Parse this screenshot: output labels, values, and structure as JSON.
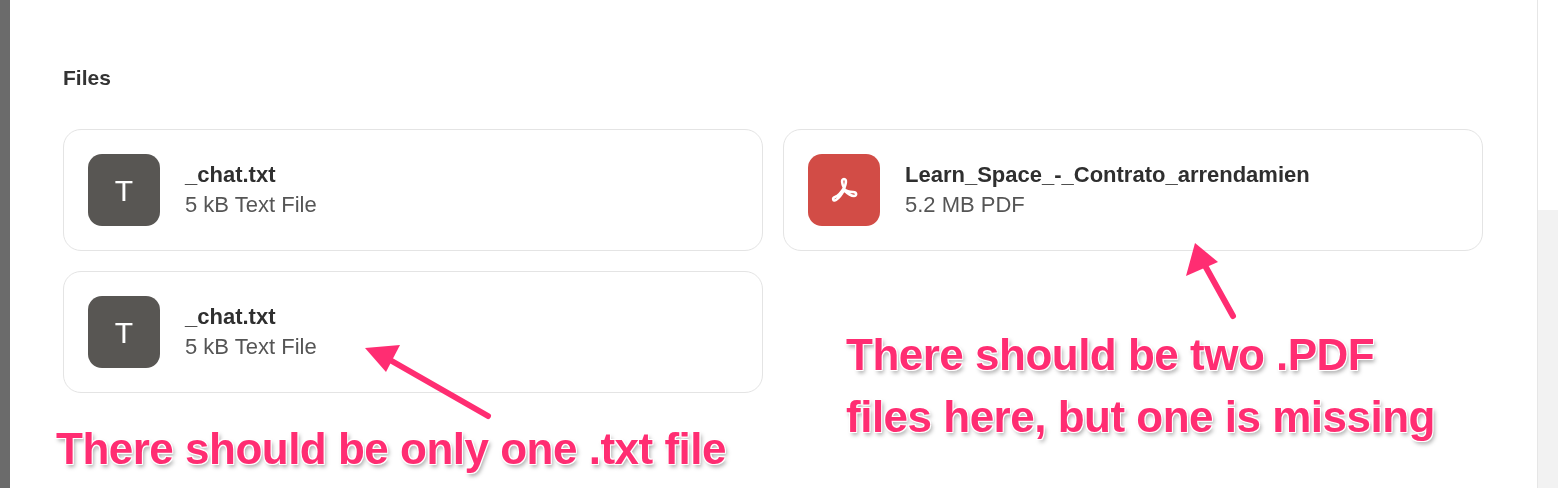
{
  "section_title": "Files",
  "files": [
    {
      "kind": "text",
      "icon_letter": "T",
      "name": "_chat.txt",
      "meta": "5 kB Text File"
    },
    {
      "kind": "pdf",
      "name": "Learn_Space_-_Contrato_arrendamien",
      "meta": "5.2 MB PDF"
    },
    {
      "kind": "text",
      "icon_letter": "T",
      "name": "_chat.txt",
      "meta": "5 kB Text File"
    }
  ],
  "annotations": [
    {
      "lines": [
        "There should be two .PDF",
        "files here, but one is missing"
      ]
    },
    {
      "lines": [
        "There should be only one .txt file"
      ]
    }
  ]
}
